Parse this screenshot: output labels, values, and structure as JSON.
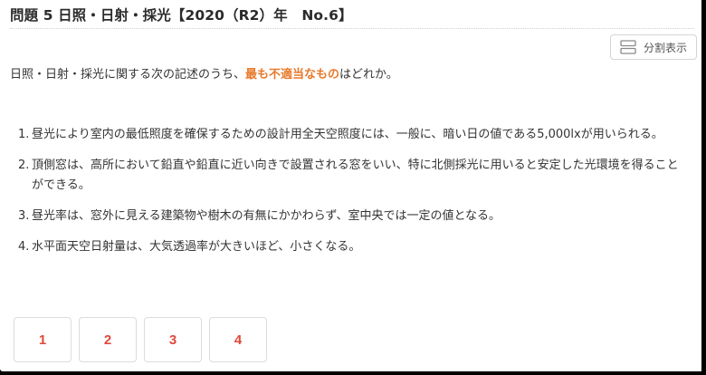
{
  "header": {
    "title": "問題 5 日照・日射・採光【2020（R2）年　No.6】"
  },
  "toolbar": {
    "split_view_label": "分割表示",
    "split_view_icon": "split-view-icon"
  },
  "question": {
    "prefix": "日照・日射・採光に関する次の記述のうち、",
    "highlight": "最も不適当なもの",
    "suffix": "はどれか。",
    "highlight_color": "#e8792b"
  },
  "options": [
    {
      "num": "1.",
      "text": "昼光により室内の最低照度を確保するための設計用全天空照度には、一般に、暗い日の値である5,000lxが用いられる。"
    },
    {
      "num": "2.",
      "text": "頂側窓は、高所において鉛直や鉛直に近い向きで設置される窓をいい、特に北側採光に用いると安定した光環境を得ることができる。"
    },
    {
      "num": "3.",
      "text": "昼光率は、窓外に見える建築物や樹木の有無にかかわらず、室中央では一定の値となる。"
    },
    {
      "num": "4.",
      "text": "水平面天空日射量は、大気透過率が大きいほど、小さくなる。"
    }
  ],
  "answers": {
    "buttons": [
      "1",
      "2",
      "3",
      "4"
    ],
    "color": "#e0483a"
  }
}
